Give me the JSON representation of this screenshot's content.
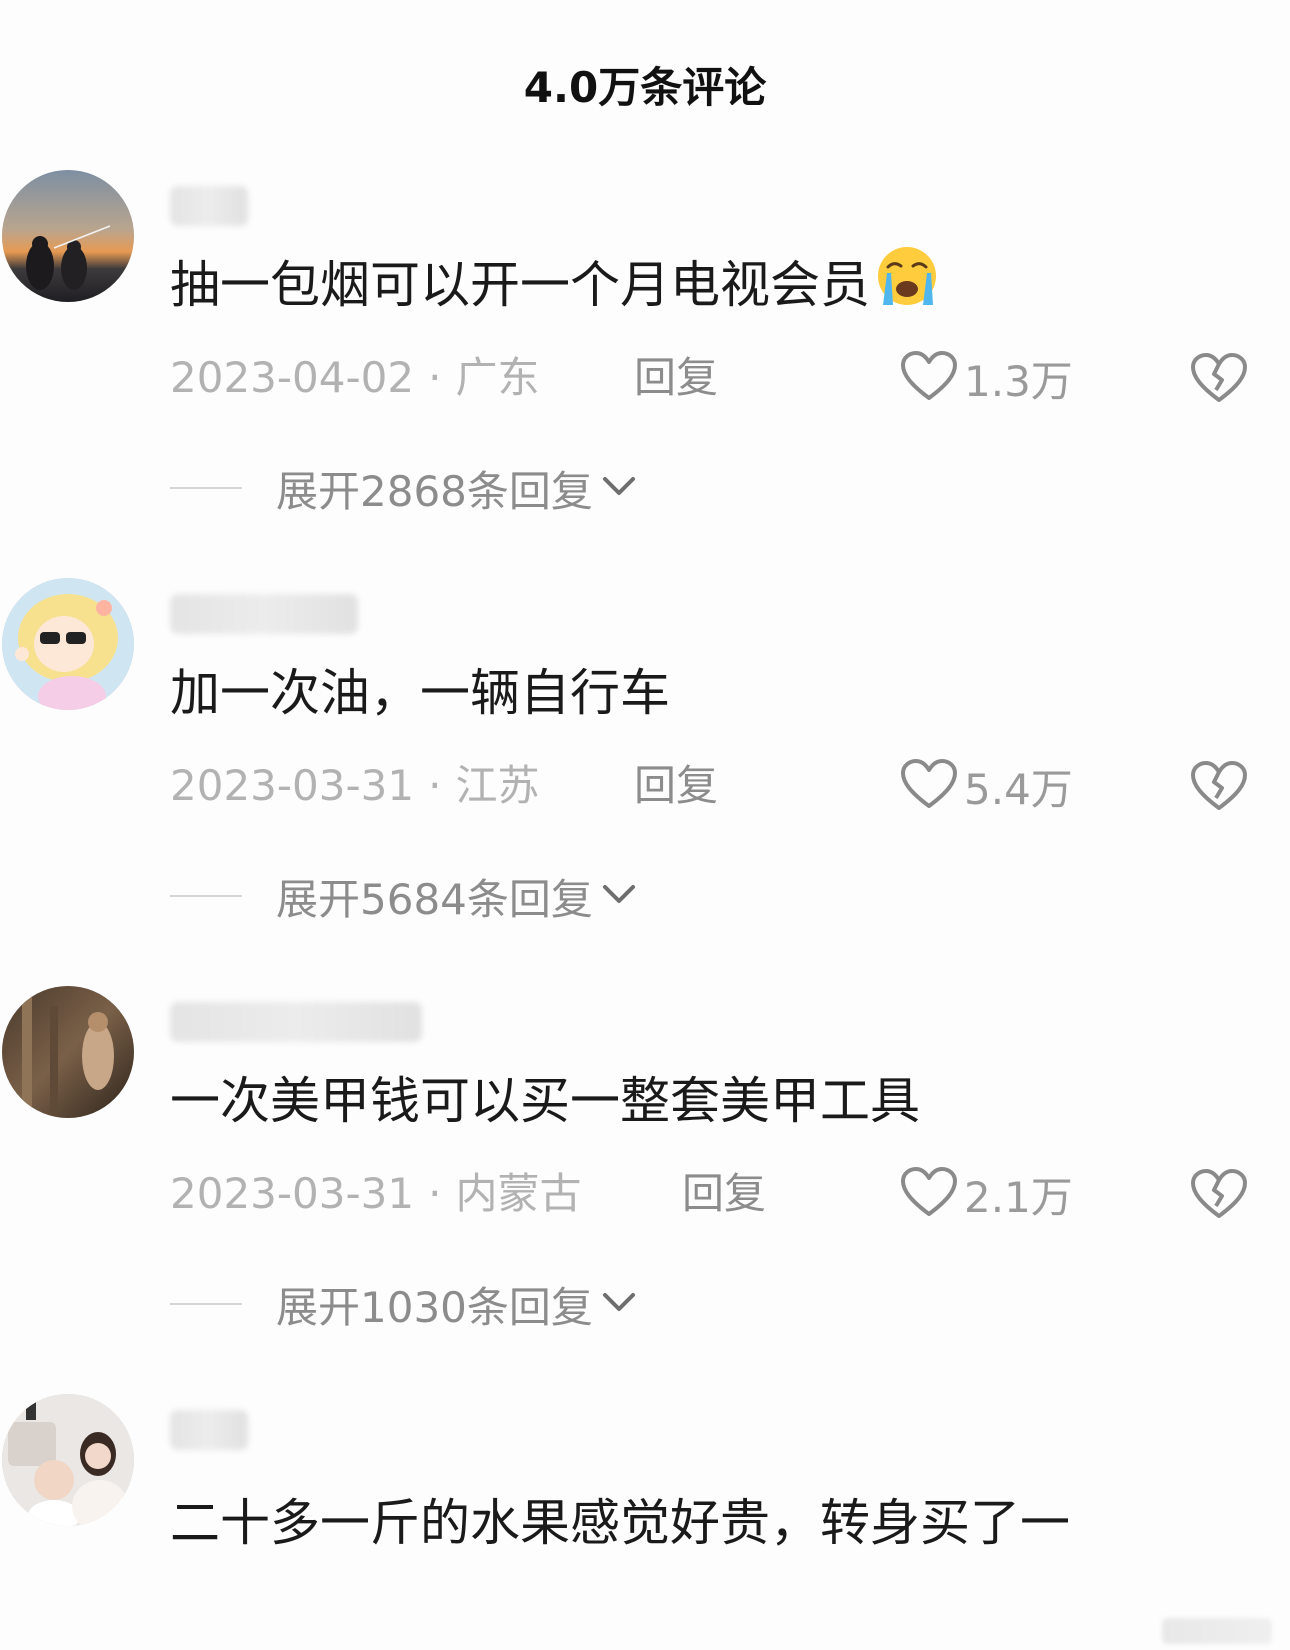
{
  "header": {
    "title": "4.0万条评论"
  },
  "comments": [
    {
      "text": "抽一包烟可以开一个月电视会员",
      "emoji": "loudly-crying-face-icon",
      "date": "2023-04-02",
      "separator": "·",
      "location": "广东",
      "reply_label": "回复",
      "likes": "1.3万",
      "expand_label": "展开2868条回复"
    },
    {
      "text": "加一次油，一辆自行车",
      "date": "2023-03-31",
      "separator": "·",
      "location": "江苏",
      "reply_label": "回复",
      "likes": "5.4万",
      "expand_label": "展开5684条回复"
    },
    {
      "text": "一次美甲钱可以买一整套美甲工具",
      "date": "2023-03-31",
      "separator": "·",
      "location": "内蒙古",
      "reply_label": "回复",
      "likes": "2.1万",
      "expand_label": "展开1030条回复"
    },
    {
      "text": "二十多一斤的水果感觉好贵，转身买了一"
    }
  ],
  "colors": {
    "background": "#fdfdfd",
    "text_primary": "#1a1a1a",
    "text_secondary": "#b2b2b2",
    "action_gray": "#8c8c8c"
  }
}
